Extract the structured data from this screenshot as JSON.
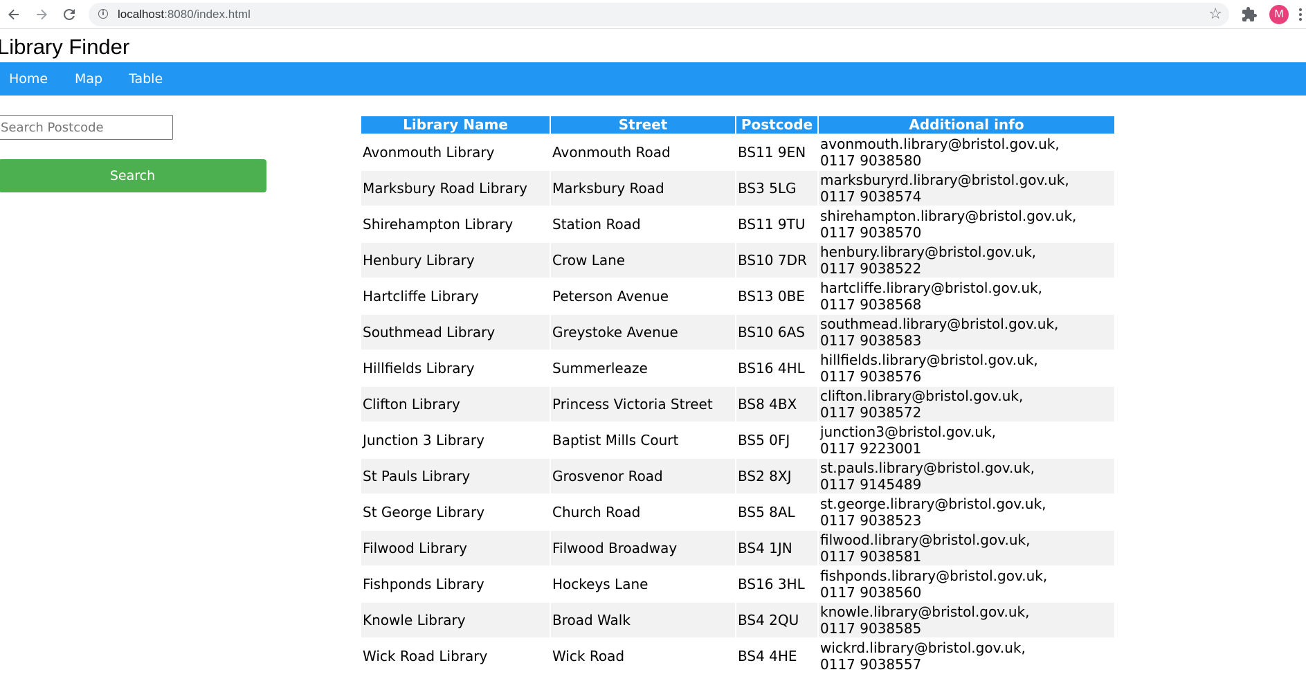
{
  "browser": {
    "url_host": "localhost",
    "url_rest": ":8080/index.html",
    "avatar_letter": "M",
    "icons": [
      "back-icon",
      "forward-icon",
      "reload-icon",
      "info-icon",
      "star-icon",
      "puzzle-icon",
      "menu-icon"
    ]
  },
  "page": {
    "title": "Library Finder"
  },
  "nav": {
    "items": [
      {
        "label": "Home"
      },
      {
        "label": "Map"
      },
      {
        "label": "Table"
      }
    ]
  },
  "search": {
    "placeholder": "Search Postcode",
    "value": "",
    "button_label": "Search"
  },
  "table": {
    "headers": [
      "Library Name",
      "Street",
      "Postcode",
      "Additional info"
    ],
    "rows": [
      {
        "name": "Avonmouth Library",
        "street": "Avonmouth Road",
        "postcode": "BS11 9EN",
        "email": "avonmouth.library@bristol.gov.uk,",
        "phone": "0117 9038580"
      },
      {
        "name": "Marksbury Road Library",
        "street": "Marksbury Road",
        "postcode": "BS3 5LG",
        "email": "marksburyrd.library@bristol.gov.uk,",
        "phone": "0117 9038574"
      },
      {
        "name": "Shirehampton Library",
        "street": "Station Road",
        "postcode": "BS11 9TU",
        "email": "shirehampton.library@bristol.gov.uk,",
        "phone": "0117 9038570"
      },
      {
        "name": "Henbury Library",
        "street": "Crow Lane",
        "postcode": "BS10 7DR",
        "email": "henbury.library@bristol.gov.uk,",
        "phone": "0117 9038522"
      },
      {
        "name": "Hartcliffe Library",
        "street": "Peterson Avenue",
        "postcode": "BS13 0BE",
        "email": "hartcliffe.library@bristol.gov.uk,",
        "phone": "0117 9038568"
      },
      {
        "name": "Southmead Library",
        "street": "Greystoke Avenue",
        "postcode": "BS10 6AS",
        "email": "southmead.library@bristol.gov.uk,",
        "phone": "0117 9038583"
      },
      {
        "name": "Hillfields Library",
        "street": "Summerleaze",
        "postcode": "BS16 4HL",
        "email": "hillfields.library@bristol.gov.uk,",
        "phone": "0117 9038576"
      },
      {
        "name": "Clifton Library",
        "street": "Princess Victoria Street",
        "postcode": "BS8 4BX",
        "email": "clifton.library@bristol.gov.uk,",
        "phone": "0117 9038572"
      },
      {
        "name": "Junction 3 Library",
        "street": "Baptist Mills Court",
        "postcode": "BS5 0FJ",
        "email": "junction3@bristol.gov.uk,",
        "phone": "0117 9223001"
      },
      {
        "name": "St Pauls Library",
        "street": "Grosvenor Road",
        "postcode": "BS2 8XJ",
        "email": "st.pauls.library@bristol.gov.uk,",
        "phone": "0117 9145489"
      },
      {
        "name": "St George Library",
        "street": "Church Road",
        "postcode": "BS5 8AL",
        "email": "st.george.library@bristol.gov.uk,",
        "phone": "0117 9038523"
      },
      {
        "name": "Filwood Library",
        "street": "Filwood Broadway",
        "postcode": "BS4 1JN",
        "email": "filwood.library@bristol.gov.uk,",
        "phone": "0117 9038581"
      },
      {
        "name": "Fishponds Library",
        "street": "Hockeys Lane",
        "postcode": "BS16 3HL",
        "email": "fishponds.library@bristol.gov.uk,",
        "phone": "0117 9038560"
      },
      {
        "name": "Knowle Library",
        "street": "Broad Walk",
        "postcode": "BS4 2QU",
        "email": "knowle.library@bristol.gov.uk,",
        "phone": "0117 9038585"
      },
      {
        "name": "Wick Road Library",
        "street": "Wick Road",
        "postcode": "BS4 4HE",
        "email": "wickrd.library@bristol.gov.uk,",
        "phone": "0117 9038557"
      }
    ]
  },
  "colors": {
    "nav_background": "#2196f3",
    "search_button": "#4caf50",
    "header_background": "#2196f3",
    "row_stripe": "#f2f2f2",
    "avatar": "#e8407a"
  }
}
